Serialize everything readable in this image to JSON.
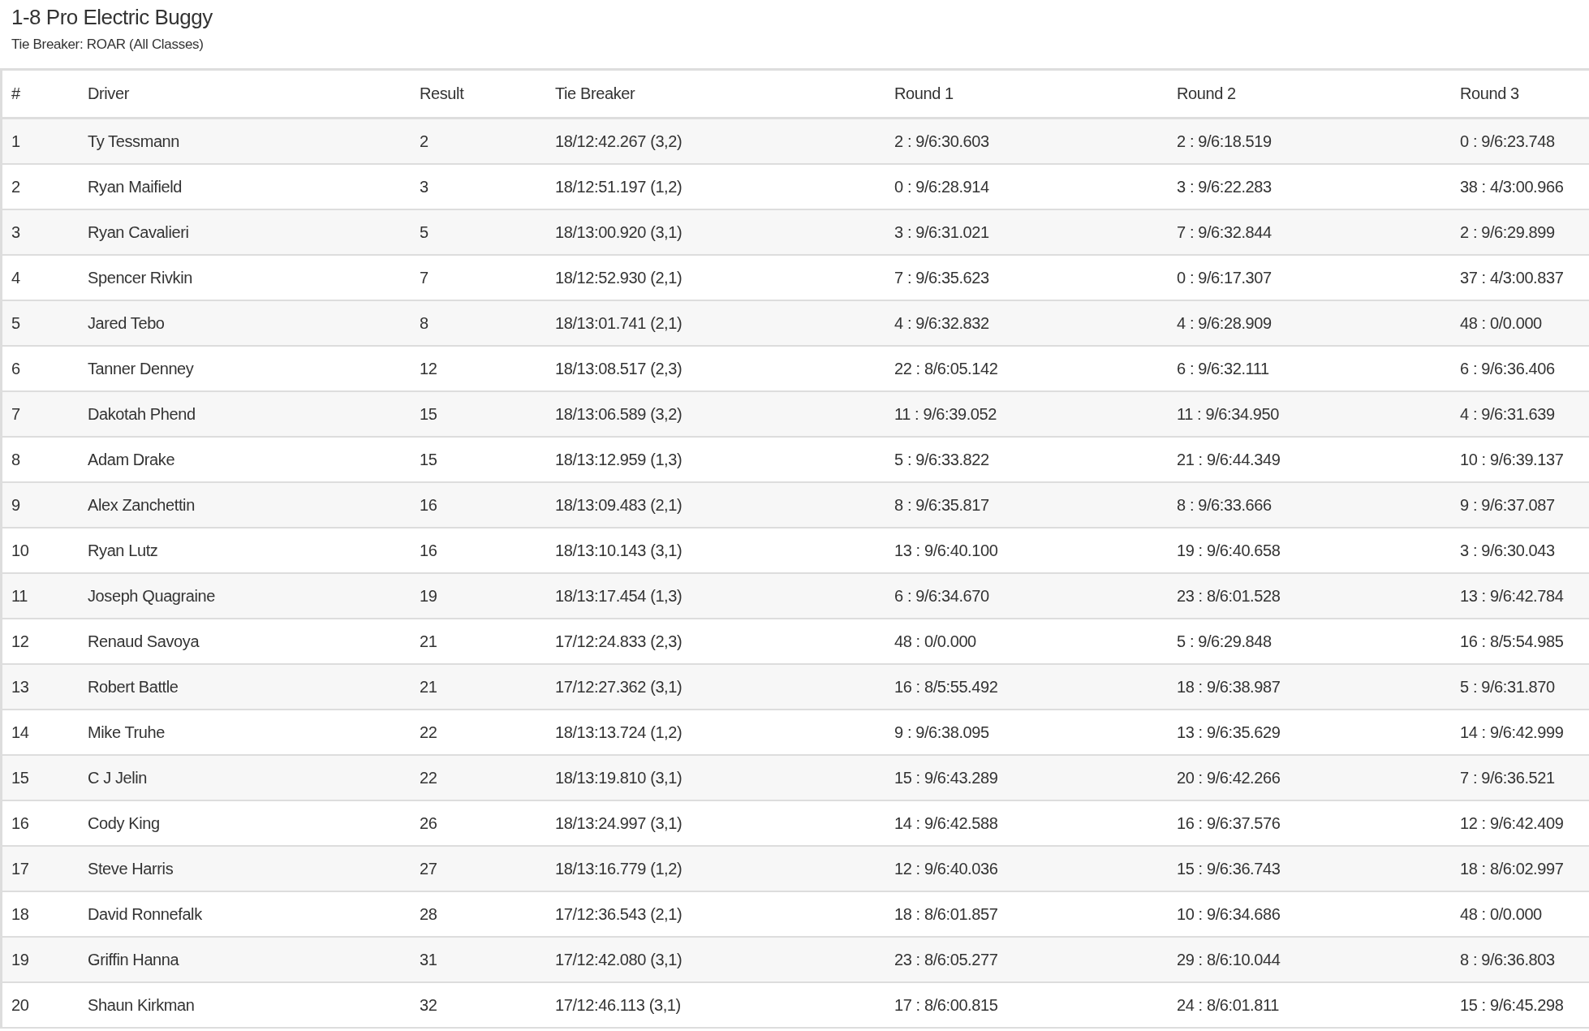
{
  "title": "1-8 Pro Electric Buggy",
  "subtitle": "Tie Breaker: ROAR (All Classes)",
  "table": {
    "columns": [
      "#",
      "Driver",
      "Result",
      "Tie Breaker",
      "Round 1",
      "Round 2",
      "Round 3"
    ],
    "rows": [
      [
        "1",
        "Ty Tessmann",
        "2",
        "18/12:42.267 (3,2)",
        "2 : 9/6:30.603",
        "2 : 9/6:18.519",
        "0 : 9/6:23.748"
      ],
      [
        "2",
        "Ryan Maifield",
        "3",
        "18/12:51.197 (1,2)",
        "0 : 9/6:28.914",
        "3 : 9/6:22.283",
        "38 : 4/3:00.966"
      ],
      [
        "3",
        "Ryan Cavalieri",
        "5",
        "18/13:00.920 (3,1)",
        "3 : 9/6:31.021",
        "7 : 9/6:32.844",
        "2 : 9/6:29.899"
      ],
      [
        "4",
        "Spencer Rivkin",
        "7",
        "18/12:52.930 (2,1)",
        "7 : 9/6:35.623",
        "0 : 9/6:17.307",
        "37 : 4/3:00.837"
      ],
      [
        "5",
        "Jared Tebo",
        "8",
        "18/13:01.741 (2,1)",
        "4 : 9/6:32.832",
        "4 : 9/6:28.909",
        "48 : 0/0.000"
      ],
      [
        "6",
        "Tanner Denney",
        "12",
        "18/13:08.517 (2,3)",
        "22 : 8/6:05.142",
        "6 : 9/6:32.111",
        "6 : 9/6:36.406"
      ],
      [
        "7",
        "Dakotah Phend",
        "15",
        "18/13:06.589 (3,2)",
        "11 : 9/6:39.052",
        "11 : 9/6:34.950",
        "4 : 9/6:31.639"
      ],
      [
        "8",
        "Adam Drake",
        "15",
        "18/13:12.959 (1,3)",
        "5 : 9/6:33.822",
        "21 : 9/6:44.349",
        "10 : 9/6:39.137"
      ],
      [
        "9",
        "Alex Zanchettin",
        "16",
        "18/13:09.483 (2,1)",
        "8 : 9/6:35.817",
        "8 : 9/6:33.666",
        "9 : 9/6:37.087"
      ],
      [
        "10",
        "Ryan Lutz",
        "16",
        "18/13:10.143 (3,1)",
        "13 : 9/6:40.100",
        "19 : 9/6:40.658",
        "3 : 9/6:30.043"
      ],
      [
        "11",
        "Joseph Quagraine",
        "19",
        "18/13:17.454 (1,3)",
        "6 : 9/6:34.670",
        "23 : 8/6:01.528",
        "13 : 9/6:42.784"
      ],
      [
        "12",
        "Renaud Savoya",
        "21",
        "17/12:24.833 (2,3)",
        "48 : 0/0.000",
        "5 : 9/6:29.848",
        "16 : 8/5:54.985"
      ],
      [
        "13",
        "Robert Battle",
        "21",
        "17/12:27.362 (3,1)",
        "16 : 8/5:55.492",
        "18 : 9/6:38.987",
        "5 : 9/6:31.870"
      ],
      [
        "14",
        "Mike Truhe",
        "22",
        "18/13:13.724 (1,2)",
        "9 : 9/6:38.095",
        "13 : 9/6:35.629",
        "14 : 9/6:42.999"
      ],
      [
        "15",
        "C J Jelin",
        "22",
        "18/13:19.810 (3,1)",
        "15 : 9/6:43.289",
        "20 : 9/6:42.266",
        "7 : 9/6:36.521"
      ],
      [
        "16",
        "Cody King",
        "26",
        "18/13:24.997 (3,1)",
        "14 : 9/6:42.588",
        "16 : 9/6:37.576",
        "12 : 9/6:42.409"
      ],
      [
        "17",
        "Steve Harris",
        "27",
        "18/13:16.779 (1,2)",
        "12 : 9/6:40.036",
        "15 : 9/6:36.743",
        "18 : 8/6:02.997"
      ],
      [
        "18",
        "David Ronnefalk",
        "28",
        "17/12:36.543 (2,1)",
        "18 : 8/6:01.857",
        "10 : 9/6:34.686",
        "48 : 0/0.000"
      ],
      [
        "19",
        "Griffin Hanna",
        "31",
        "17/12:42.080 (3,1)",
        "23 : 8/6:05.277",
        "29 : 8/6:10.044",
        "8 : 9/6:36.803"
      ],
      [
        "20",
        "Shaun Kirkman",
        "32",
        "17/12:46.113 (3,1)",
        "17 : 8/6:00.815",
        "24 : 8/6:01.811",
        "15 : 9/6:45.298"
      ]
    ]
  }
}
